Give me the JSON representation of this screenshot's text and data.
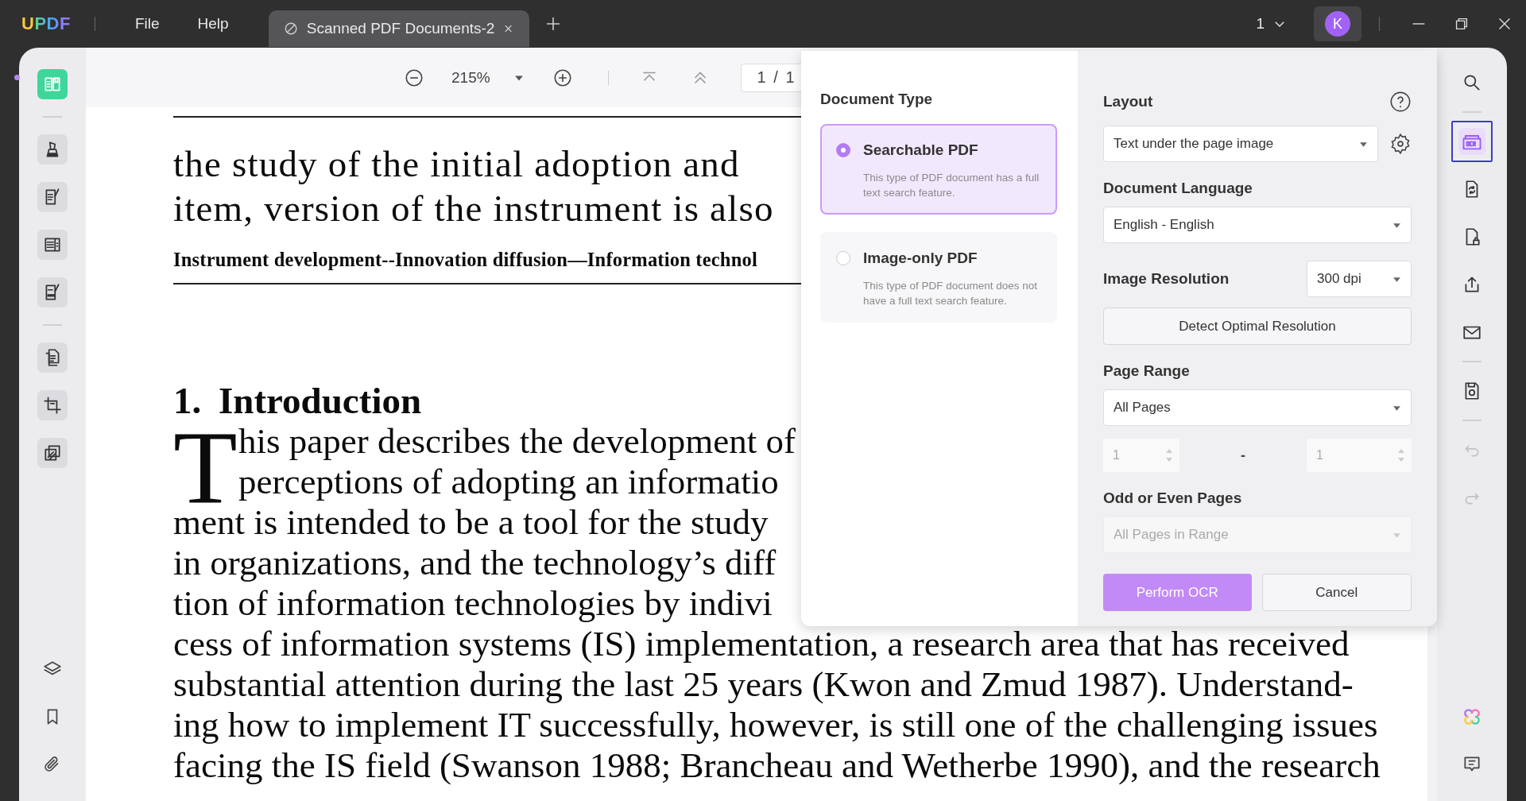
{
  "title_bar": {
    "logo": "UPDF",
    "menu": [
      {
        "label": "File"
      },
      {
        "label": "Help"
      }
    ],
    "tabs": [
      {
        "title": "Scanned PDF Documents-2",
        "selected": true
      }
    ],
    "window_count": "1",
    "avatar": "K"
  },
  "left_tools": [
    {
      "selected": true
    },
    {
      "selected": false
    },
    {
      "selected": false
    },
    {
      "selected": false
    },
    {
      "selected": false
    },
    {
      "selected": false
    },
    {
      "selected": false
    },
    {
      "selected": false
    }
  ],
  "view_toolbar": {
    "zoom": "215%",
    "page": "1 / 1"
  },
  "document": {
    "header_lines": [
      "the study of the initial adoption and",
      "item, version of the instrument is also"
    ],
    "keywords": "Instrument development--Innovation diffusion—Information technol",
    "heading": "1. Introduction",
    "drop_cap": "T",
    "paragraph": [
      "his paper describes the development of",
      "perceptions of adopting an informatio",
      "ment is intended to be a tool for the study",
      "in organizations, and the technology’s diff",
      "tion of information technologies by indivi",
      "cess of information systems (IS) implementation, a research area that has received",
      "substantial attention during the last 25 years (Kwon and Zmud 1987). Understand-",
      "ing how to implement IT successfully, however, is still one of the challenging issues",
      "facing the IS field (Swanson 1988; Brancheau and Wetherbe 1990), and the research"
    ]
  },
  "ocr_dialog": {
    "document_type": {
      "title": "Document Type",
      "options": [
        {
          "label": "Searchable PDF",
          "description": "This type of PDF document has a full text search feature.",
          "selected": true
        },
        {
          "label": "Image-only PDF",
          "description": "This type of PDF document does not have a full text search feature.",
          "selected": false
        }
      ]
    },
    "layout": {
      "label": "Layout",
      "value": "Text under the page image"
    },
    "language": {
      "label": "Document Language",
      "value": "English - English"
    },
    "resolution": {
      "label": "Image Resolution",
      "value": "300 dpi"
    },
    "detect_button": "Detect Optimal Resolution",
    "page_range": {
      "label": "Page Range",
      "value": "All Pages",
      "from": "1",
      "separator": "-",
      "to": "1",
      "range_disabled": true
    },
    "odd_even": {
      "label": "Odd or Even Pages",
      "value": "All Pages in Range",
      "disabled": true
    },
    "buttons": [
      {
        "label": "Perform OCR",
        "kind": "primary"
      },
      {
        "label": "Cancel",
        "kind": "secondary"
      }
    ]
  },
  "right_tools": [
    {
      "selected": false,
      "disabled": false
    },
    {
      "selected": true,
      "disabled": false
    },
    {
      "selected": false,
      "disabled": false
    },
    {
      "selected": false,
      "disabled": false
    },
    {
      "selected": false,
      "disabled": false
    },
    {
      "selected": false,
      "disabled": false
    },
    {
      "selected": false,
      "disabled": false
    },
    {
      "selected": false,
      "disabled": true
    },
    {
      "selected": false,
      "disabled": true
    }
  ]
}
